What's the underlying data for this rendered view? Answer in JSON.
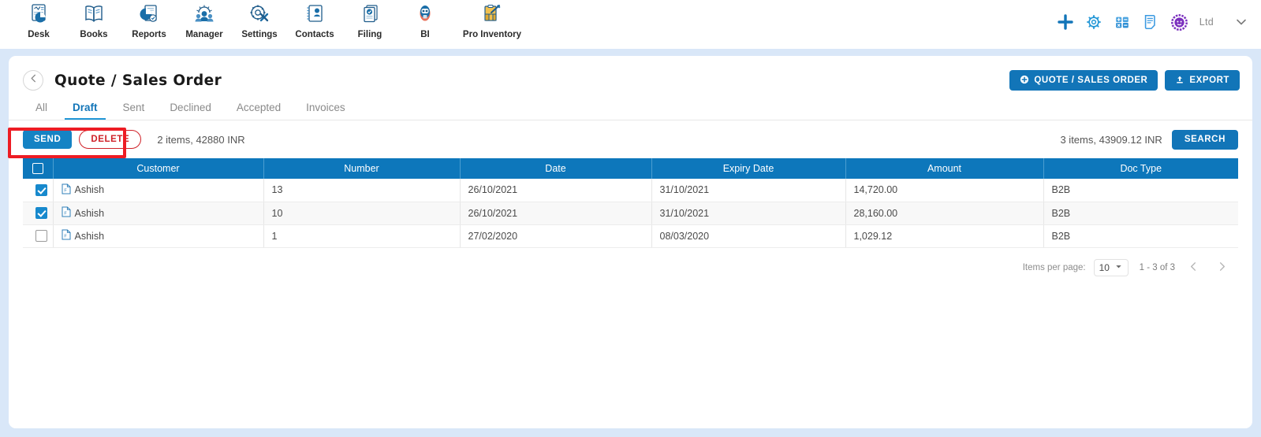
{
  "topnav": {
    "apps": [
      {
        "label": "Desk",
        "icon": "desk-dashboard-icon"
      },
      {
        "label": "Books",
        "icon": "books-ledger-icon"
      },
      {
        "label": "Reports",
        "icon": "reports-piechart-icon"
      },
      {
        "label": "Manager",
        "icon": "manager-people-icon"
      },
      {
        "label": "Settings",
        "icon": "settings-tools-icon"
      },
      {
        "label": "Contacts",
        "icon": "contacts-card-icon"
      },
      {
        "label": "Filing",
        "icon": "filing-documents-icon"
      },
      {
        "label": "BI",
        "icon": "bi-robot-icon"
      },
      {
        "label": "Pro Inventory",
        "icon": "pro-inventory-clipboard-icon"
      }
    ],
    "right_icons": [
      {
        "name": "add-plus-icon",
        "color": "#1275b8"
      },
      {
        "name": "gear-icon",
        "color": "#2196d6"
      },
      {
        "name": "calculator-icon",
        "color": "#3b9ae1"
      },
      {
        "name": "notes-icon",
        "color": "#3b9ae1"
      },
      {
        "name": "user-avatar-icon",
        "color": "#7b2fbe"
      }
    ],
    "org_name": "Ltd",
    "chevron_icon": "chevron-down-icon"
  },
  "header": {
    "back_icon": "chevron-left-icon",
    "title": "Quote / Sales Order",
    "create_button": {
      "label": "QUOTE / SALES ORDER",
      "icon": "plus-circle-icon"
    },
    "export_button": {
      "label": "EXPORT",
      "icon": "upload-icon"
    }
  },
  "tabs": [
    {
      "label": "All",
      "active": false
    },
    {
      "label": "Draft",
      "active": true
    },
    {
      "label": "Sent",
      "active": false
    },
    {
      "label": "Declined",
      "active": false
    },
    {
      "label": "Accepted",
      "active": false
    },
    {
      "label": "Invoices",
      "active": false
    }
  ],
  "toolbar": {
    "send_label": "SEND",
    "delete_label": "DELETE",
    "selection_summary": "2 items, 42880 INR",
    "total_summary": "3 items, 43909.12 INR",
    "search_label": "SEARCH",
    "highlight_color": "#ed1c24"
  },
  "table": {
    "columns": [
      "Customer",
      "Number",
      "Date",
      "Expiry Date",
      "Amount",
      "Doc Type"
    ],
    "header_select_all_checked": false,
    "rows": [
      {
        "selected": true,
        "doc_icon": "document-icon",
        "customer": "Ashish",
        "number": "13",
        "date": "26/10/2021",
        "expiry_date": "31/10/2021",
        "amount": "14,720.00",
        "doc_type": "B2B"
      },
      {
        "selected": true,
        "doc_icon": "document-icon",
        "customer": "Ashish",
        "number": "10",
        "date": "26/10/2021",
        "expiry_date": "31/10/2021",
        "amount": "28,160.00",
        "doc_type": "B2B"
      },
      {
        "selected": false,
        "doc_icon": "document-icon",
        "customer": "Ashish",
        "number": "1",
        "date": "27/02/2020",
        "expiry_date": "08/03/2020",
        "amount": "1,029.12",
        "doc_type": "B2B"
      }
    ]
  },
  "paginator": {
    "items_per_page_label": "Items per page:",
    "items_per_page_value": "10",
    "range_label": "1 - 3 of 3",
    "prev_icon": "chevron-left-icon",
    "next_icon": "chevron-right-icon"
  },
  "theme": {
    "page_bg": "#d9e7f8",
    "accent": "#1275b8",
    "table_header": "#0d77bb",
    "danger": "#cf2027"
  }
}
